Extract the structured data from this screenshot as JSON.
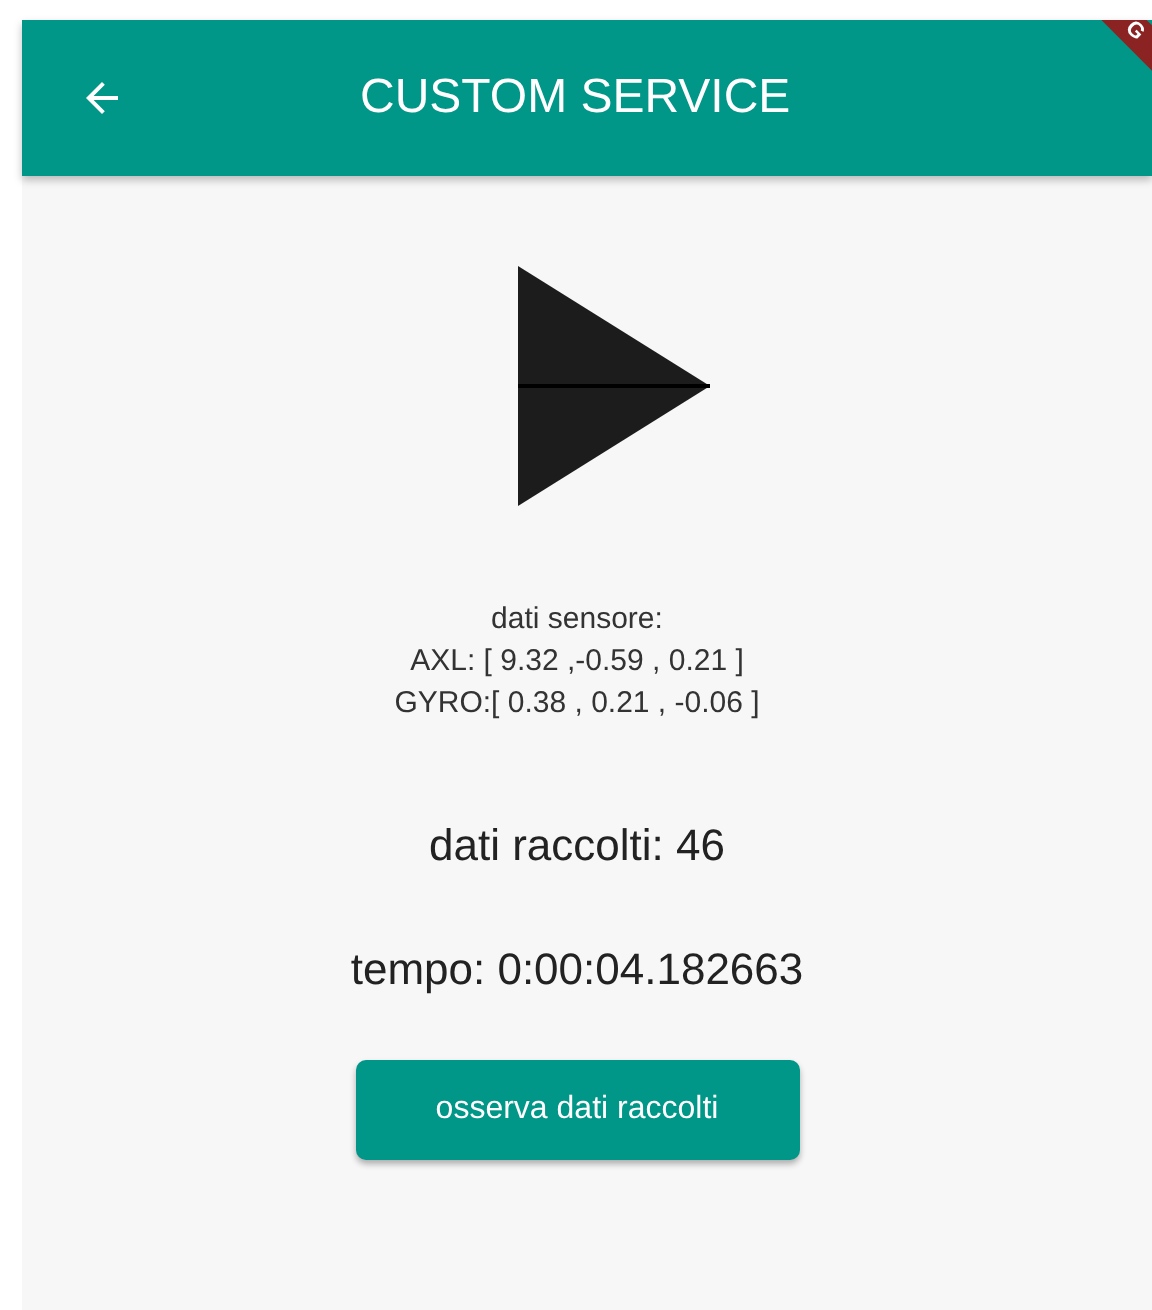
{
  "app_bar": {
    "title": "CUSTOM SERVICE",
    "debug_banner": "G"
  },
  "sensor": {
    "heading": "dati sensore:",
    "lines": [
      "AXL: [ 9.32 ,-0.59 , 0.21 ]",
      "GYRO:[ 0.38 , 0.21 , -0.06 ]"
    ]
  },
  "collected": "dati raccolti: 46",
  "time": "tempo: 0:00:04.182663",
  "button": "osserva dati raccolti"
}
